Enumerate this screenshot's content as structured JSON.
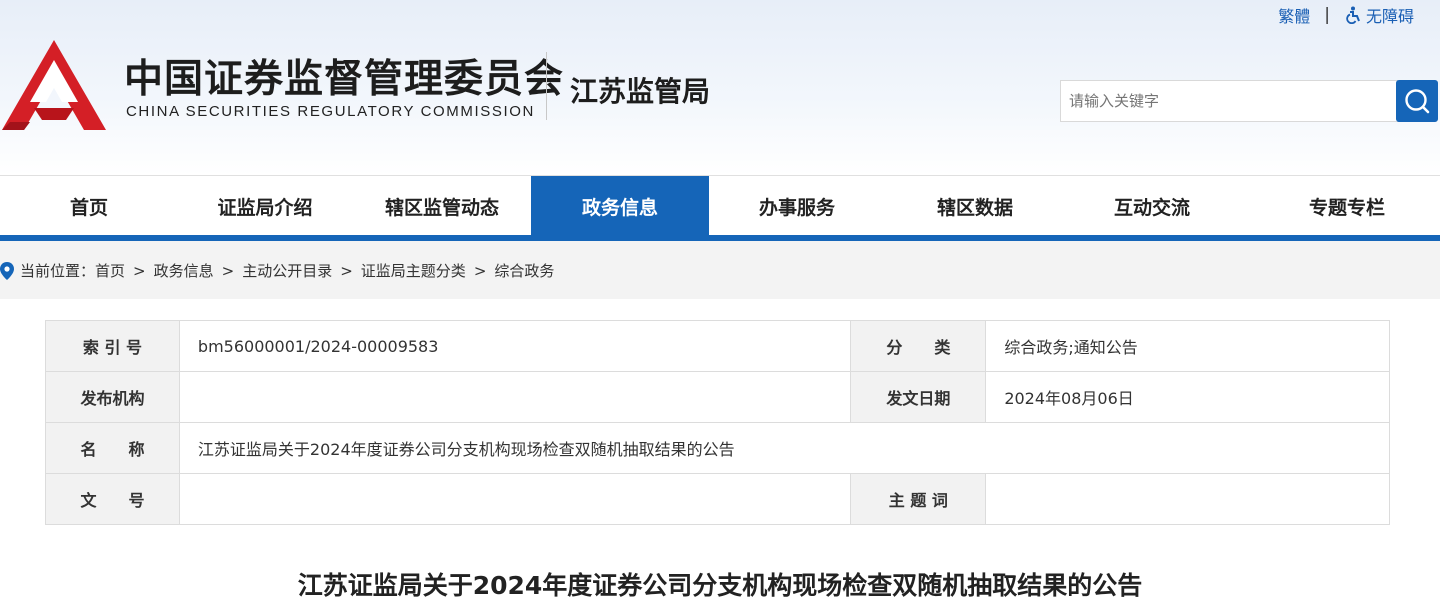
{
  "top_links": {
    "traditional": "繁體",
    "separator": "|",
    "accessibility": "无障碍"
  },
  "logo": {
    "name_cn": "中国证券监督管理委员会",
    "name_en": "CHINA SECURITIES REGULATORY COMMISSION",
    "bureau": "江苏监管局"
  },
  "search": {
    "placeholder": "请输入关键字"
  },
  "nav": {
    "items": [
      {
        "label": "首页"
      },
      {
        "label": "证监局介绍"
      },
      {
        "label": "辖区监管动态"
      },
      {
        "label": "政务信息"
      },
      {
        "label": "办事服务"
      },
      {
        "label": "辖区数据"
      },
      {
        "label": "互动交流"
      },
      {
        "label": "专题专栏"
      }
    ],
    "active_index": 3
  },
  "breadcrumb": {
    "prefix": "当前位置：",
    "items": [
      "首页",
      "政务信息",
      "主动公开目录",
      "证监局主题分类",
      "综合政务"
    ],
    "separator": ">"
  },
  "info": {
    "index_label": "索 引 号",
    "index_value": "bm56000001/2024-00009583",
    "category_label": "分　　类",
    "category_value": "综合政务;通知公告",
    "publisher_label": "发布机构",
    "publisher_value": "",
    "date_label": "发文日期",
    "date_value": "2024年08月06日",
    "name_label": "名　　称",
    "name_value": "江苏证监局关于2024年度证券公司分支机构现场检查双随机抽取结果的公告",
    "doc_no_label": "文　　号",
    "doc_no_value": "",
    "keywords_label": "主 题 词",
    "keywords_value": ""
  },
  "article": {
    "title": "江苏证监局关于2024年度证券公司分支机构现场检查双随机抽取结果的公告"
  },
  "colors": {
    "brand_blue": "#1565b8",
    "logo_red": "#d41f26"
  }
}
